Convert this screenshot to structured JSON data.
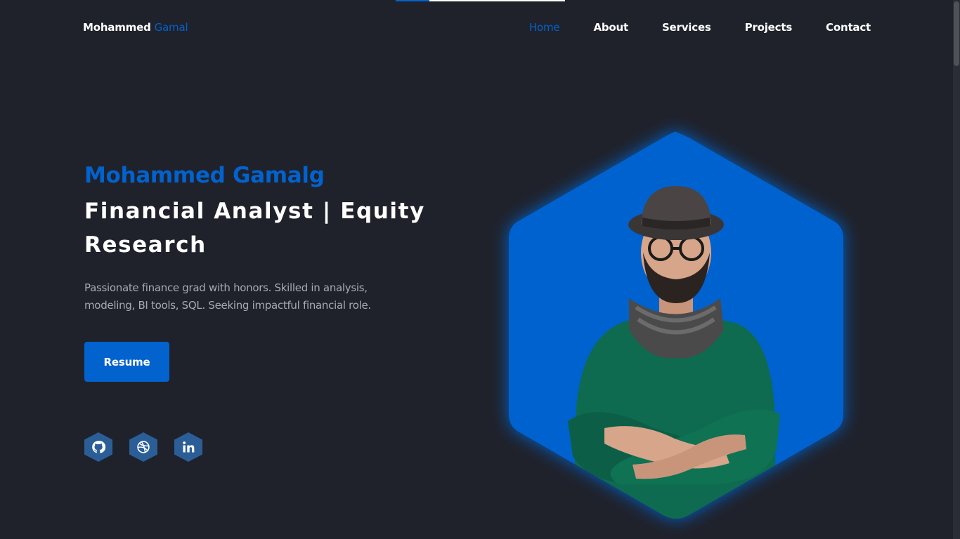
{
  "header": {
    "logo_first": "Mohammed",
    "logo_accent": "Gamal",
    "scroll_progress_percent": 20,
    "nav": {
      "home": "Home",
      "about": "About",
      "services": "Services",
      "projects": "Projects",
      "contact": "Contact"
    },
    "active_nav": "home"
  },
  "hero": {
    "name": "Mohammed Gamalg",
    "title": "Financial Analyst | Equity Research",
    "description": "Passionate finance grad with honors. Skilled in analysis, modeling, BI tools, SQL. Seeking impactful financial role.",
    "resume_label": "Resume"
  },
  "socials": [
    {
      "icon": "github-icon"
    },
    {
      "icon": "dribbble-icon"
    },
    {
      "icon": "linkedin-icon"
    }
  ],
  "colors": {
    "background": "#1f222b",
    "accent": "#0262ce",
    "text": "#ffffff",
    "muted_text": "#a6a9b2",
    "social_bg": "#2b5e97"
  }
}
